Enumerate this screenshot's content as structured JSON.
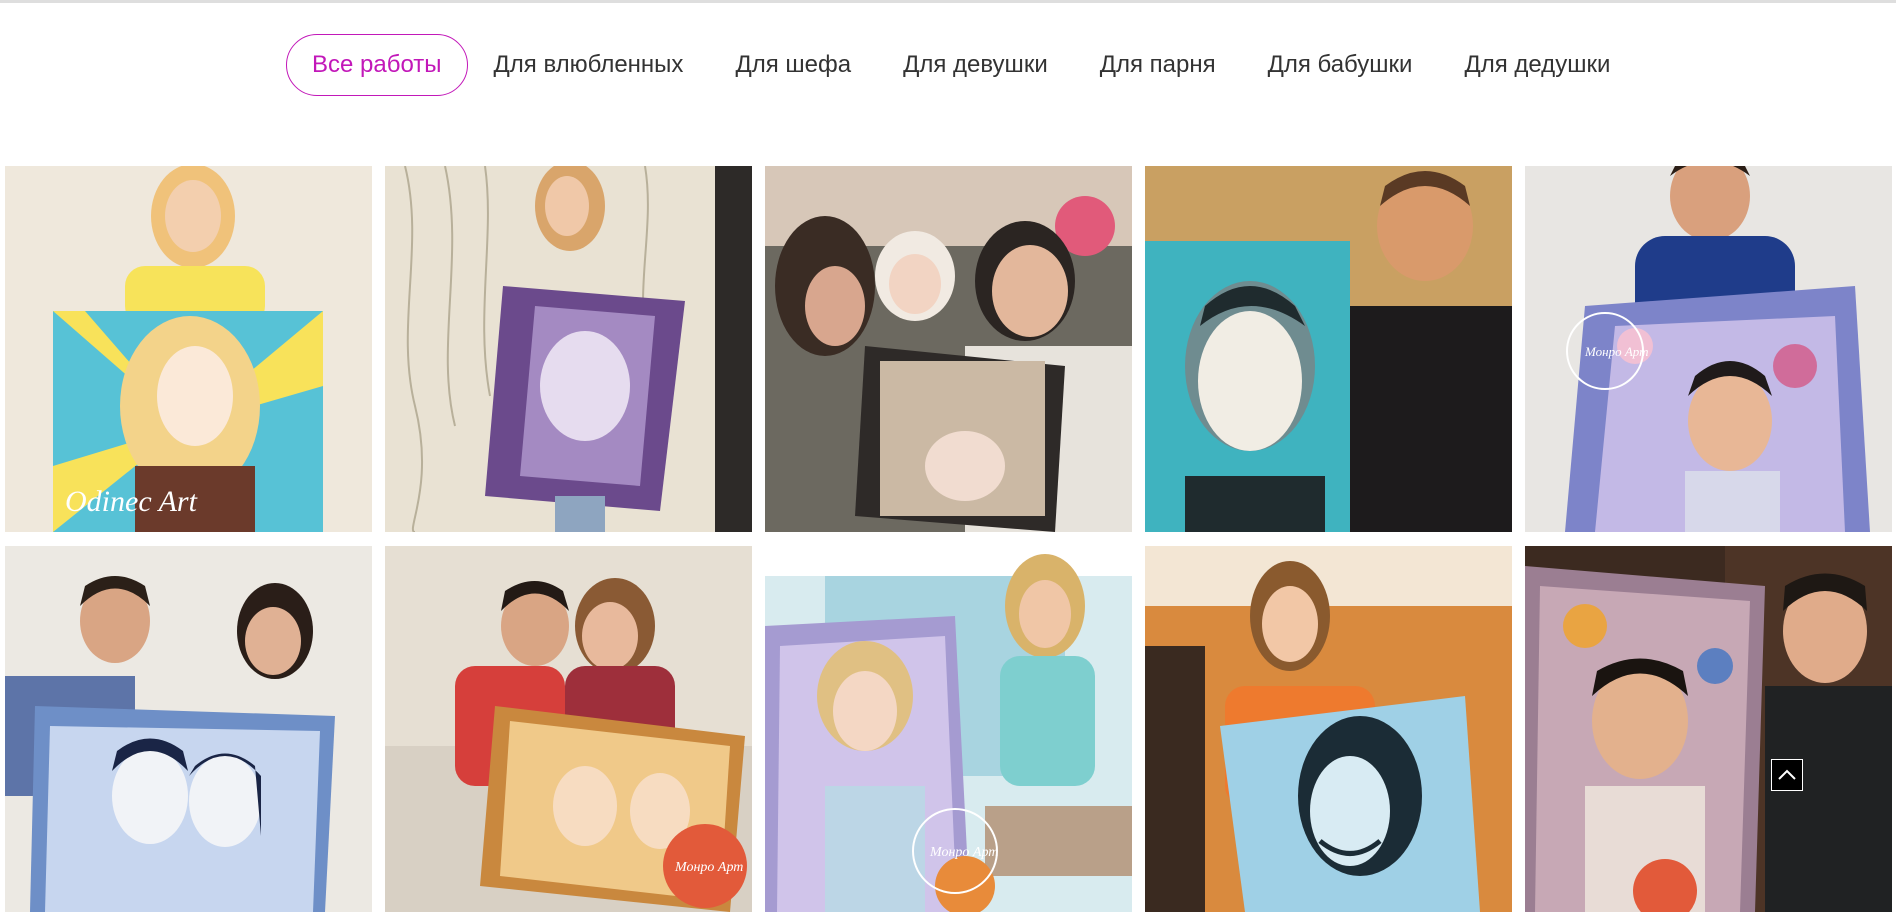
{
  "filters": [
    {
      "label": "Все работы",
      "active": true
    },
    {
      "label": "Для влюбленных",
      "active": false
    },
    {
      "label": "Для шефа",
      "active": false
    },
    {
      "label": "Для девушки",
      "active": false
    },
    {
      "label": "Для парня",
      "active": false
    },
    {
      "label": "Для бабушки",
      "active": false
    },
    {
      "label": "Для дедушки",
      "active": false
    }
  ],
  "gallery": {
    "watermarks": {
      "odinec": "Odinec Art",
      "monro": "Монро Арт"
    }
  },
  "icons": {
    "scroll_top": "chevron-up-icon"
  },
  "colors": {
    "accent": "#c218b9",
    "text": "#333333"
  }
}
